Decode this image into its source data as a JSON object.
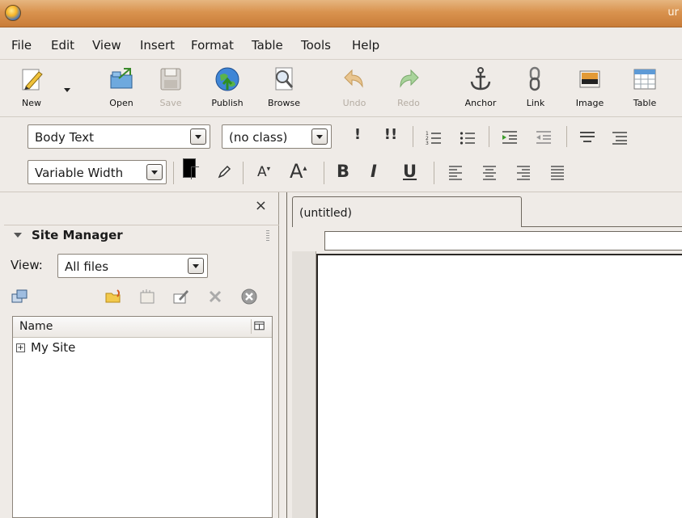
{
  "window": {
    "title_partial": "ur"
  },
  "menu": [
    "File",
    "Edit",
    "View",
    "Insert",
    "Format",
    "Table",
    "Tools",
    "Help"
  ],
  "toolbar": {
    "new": "New",
    "open": "Open",
    "save": "Save",
    "publish": "Publish",
    "browse": "Browse",
    "undo": "Undo",
    "redo": "Redo",
    "anchor": "Anchor",
    "link": "Link",
    "image": "Image",
    "table": "Table"
  },
  "format": {
    "paragraph_style": "Body Text",
    "class": "(no class)",
    "font": "Variable Width"
  },
  "side_panel": {
    "close": "×",
    "title": "Site Manager",
    "view_label": "View:",
    "view_value": "All files",
    "tree_column": "Name",
    "tree_items": [
      "My Site"
    ]
  },
  "editor": {
    "tab_label": "(untitled)"
  },
  "colors": {
    "titlebar": "#d9934f",
    "text_color_swatch": "#000000"
  }
}
